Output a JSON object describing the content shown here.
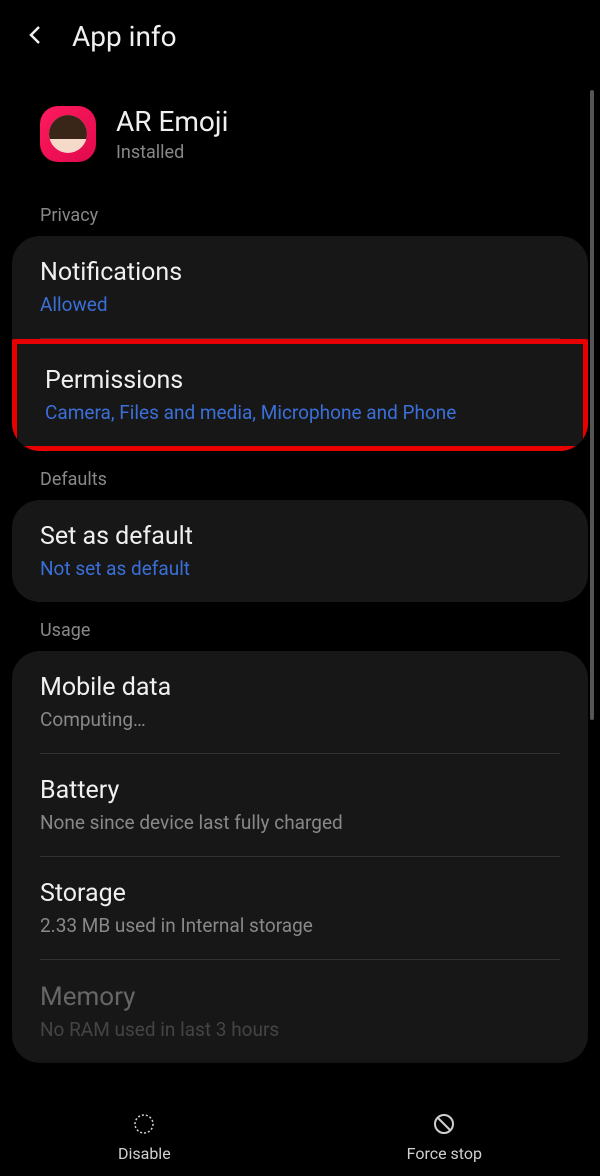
{
  "header": {
    "title": "App info"
  },
  "app": {
    "name": "AR Emoji",
    "status": "Installed"
  },
  "sections": {
    "privacy": {
      "header": "Privacy",
      "notifications": {
        "title": "Notifications",
        "value": "Allowed"
      },
      "permissions": {
        "title": "Permissions",
        "value": "Camera, Files and media, Microphone and Phone"
      }
    },
    "defaults": {
      "header": "Defaults",
      "setAsDefault": {
        "title": "Set as default",
        "value": "Not set as default"
      }
    },
    "usage": {
      "header": "Usage",
      "mobileData": {
        "title": "Mobile data",
        "value": "Computing…"
      },
      "battery": {
        "title": "Battery",
        "value": "None since device last fully charged"
      },
      "storage": {
        "title": "Storage",
        "value": "2.33 MB used in Internal storage"
      },
      "memory": {
        "title": "Memory",
        "value": "No RAM used in last 3 hours"
      }
    }
  },
  "bottomBar": {
    "disable": "Disable",
    "forceStop": "Force stop"
  }
}
